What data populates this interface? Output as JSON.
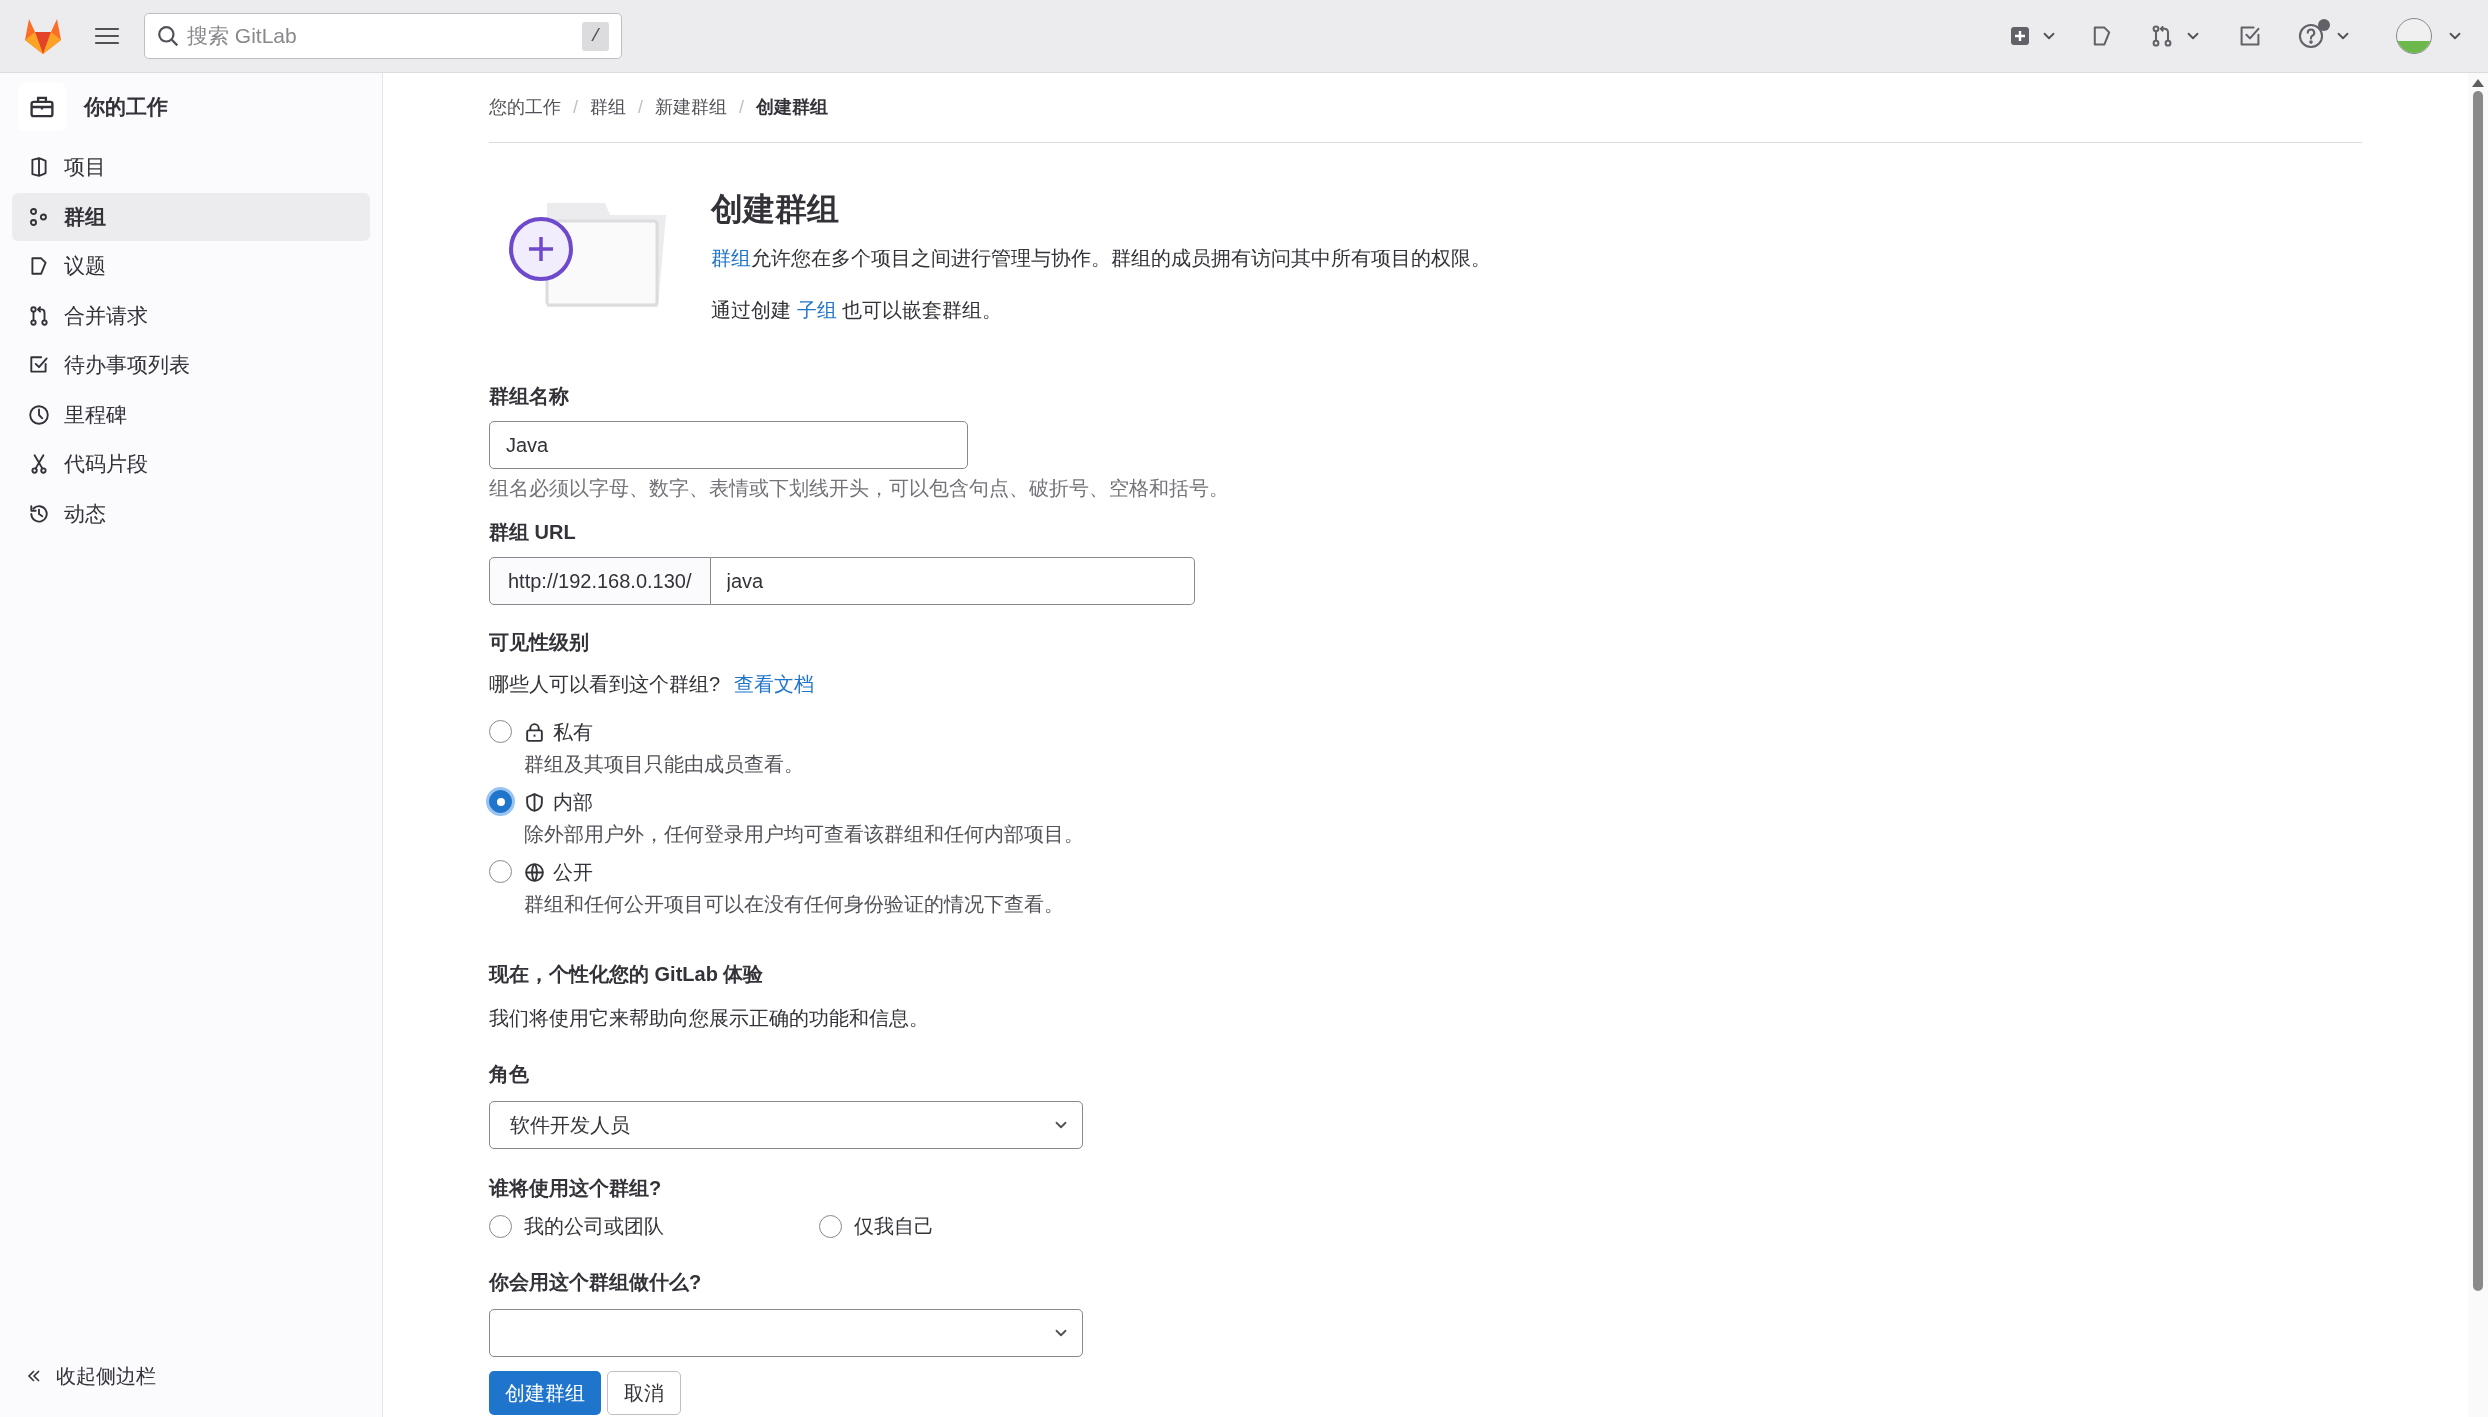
{
  "top_bar": {
    "search": {
      "placeholder": "搜索 GitLab",
      "shortcut": "/"
    }
  },
  "sidebar": {
    "title": "你的工作",
    "items": [
      {
        "label": "项目",
        "selected": false
      },
      {
        "label": "群组",
        "selected": true
      },
      {
        "label": "议题",
        "selected": false
      },
      {
        "label": "合并请求",
        "selected": false
      },
      {
        "label": "待办事项列表",
        "selected": false
      },
      {
        "label": "里程碑",
        "selected": false
      },
      {
        "label": "代码片段",
        "selected": false
      },
      {
        "label": "动态",
        "selected": false
      }
    ],
    "collapse": "收起侧边栏"
  },
  "breadcrumb": {
    "separator": "/",
    "items": [
      "您的工作",
      "群组",
      "新建群组",
      "创建群组"
    ]
  },
  "header": {
    "title": "创建群组",
    "intro": {
      "link": "群组",
      "text": "允许您在多个项目之间进行管理与协作。群组的成员拥有访问其中所有项目的权限。"
    },
    "nesting": {
      "before": "通过创建 ",
      "link": "子组",
      "after": " 也可以嵌套群组。"
    }
  },
  "group_name": {
    "label": "群组名称",
    "value": "Java",
    "hint": "组名必须以字母、数字、表情或下划线开头，可以包含句点、破折号、空格和括号。"
  },
  "group_url": {
    "label": "群组 URL",
    "prefix": "http://192.168.0.130/",
    "value": "java"
  },
  "visibility": {
    "label": "可见性级别",
    "question": "哪些人可以看到这个群组?",
    "docs_link": "查看文档",
    "options": [
      {
        "label": "私有",
        "description": "群组及其项目只能由成员查看。",
        "selected": false
      },
      {
        "label": "内部",
        "description": "除外部用户外，任何登录用户均可查看该群组和任何内部项目。",
        "selected": true
      },
      {
        "label": "公开",
        "description": "群组和任何公开项目可以在没有任何身份验证的情况下查看。",
        "selected": false
      }
    ]
  },
  "personalize": {
    "title": "现在，个性化您的 GitLab 体验",
    "description": "我们将使用它来帮助向您展示正确的功能和信息。"
  },
  "role": {
    "label": "角色",
    "value": "软件开发人员"
  },
  "audience": {
    "label": "谁将使用这个群组?",
    "options": [
      {
        "label": "我的公司或团队",
        "selected": false
      },
      {
        "label": "仅我自己",
        "selected": false
      }
    ]
  },
  "purpose": {
    "label": "你会用这个群组做什么?"
  },
  "buttons": [
    {
      "label": "创建群组",
      "kind": "primary"
    },
    {
      "label": "取消",
      "kind": "secondary"
    }
  ]
}
